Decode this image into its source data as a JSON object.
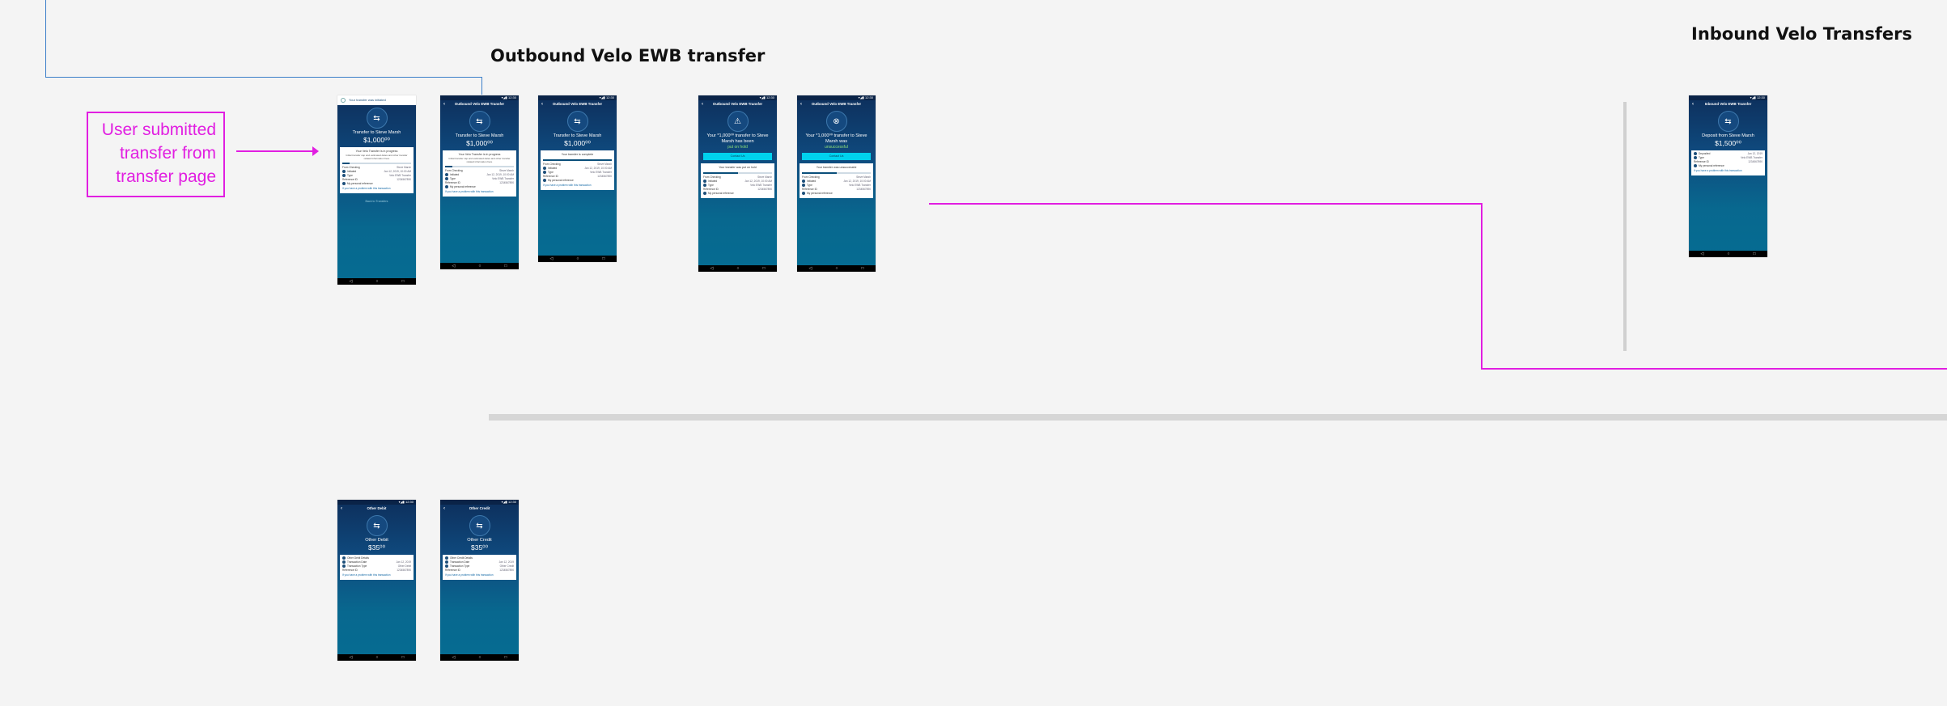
{
  "headings": {
    "outbound": "Outbound Velo EWB transfer",
    "inbound": "Inbound Velo Transfers"
  },
  "annotation": {
    "text": "User submitted transfer from transfer page"
  },
  "colors": {
    "background": "#f4f4f4",
    "annotation_magenta": "#e11ee1",
    "connector_blue": "#3b7fc9",
    "phone_top": "#0d2f5c",
    "phone_bottom": "#056c92",
    "cta_cyan": "#00d2ee"
  },
  "icons": {
    "back": "arrow-left-icon",
    "transfer": "transfer-arrows-icon",
    "nav_back": "triangle-back-icon",
    "nav_home": "circle-home-icon",
    "nav_recents": "square-recents-icon"
  },
  "nav": {
    "back": "◁",
    "home": "○",
    "recents": "□"
  },
  "screens": {
    "s1": {
      "banner": "Your transfer was initiated",
      "title": "Transfer to Steve Marsh",
      "amount": "$1,000⁰⁰",
      "card_head": "Your Velo Transfer is in progress",
      "card_text": "Initial transfer cap and estimated dates and other transfer related information here",
      "from": "From Checking",
      "to": "Steve Marsh",
      "rows": [
        [
          "Initiated",
          "Jan 12, 2019, 10:00 AM"
        ],
        [
          "Type",
          "Velo EWB Transfer"
        ],
        [
          "Reference ID",
          "1234567890"
        ]
      ],
      "memo": "My personal reference",
      "link": "If you have a problem with this transaction",
      "footer": "Back to Transfers"
    },
    "s2": {
      "appbar": "Outbound Velo EWB Transfer",
      "title": "Transfer to Steve Marsh",
      "amount": "$1,000⁰⁰",
      "card_head": "Your Velo Transfer is in progress",
      "card_text": "Initial transfer cap and estimated dates and other transfer related information here",
      "from": "From Checking",
      "to": "Steve Marsh",
      "rows": [
        [
          "Initiated",
          "Jan 12, 2019, 10:00 AM"
        ],
        [
          "Type",
          "Velo EWB Transfer"
        ],
        [
          "Reference ID",
          "1234567890"
        ]
      ],
      "memo": "My personal reference",
      "link": "If you have a problem with this transaction"
    },
    "s3": {
      "appbar": "Outbound Velo EWB Transfer",
      "title": "Transfer to Steve Marsh",
      "amount": "$1,000⁰⁰",
      "card_head": "Your transfer is complete",
      "from": "From Checking",
      "to": "Steve Marsh",
      "rows": [
        [
          "Initiated",
          "Jan 12, 2019, 10:00 AM"
        ],
        [
          "Type",
          "Velo EWB Transfer"
        ],
        [
          "Reference ID",
          "1234567890"
        ]
      ],
      "memo": "My personal reference",
      "link": "If you have a problem with this transaction"
    },
    "s4": {
      "appbar": "Outbound Velo EWB Transfer",
      "message": "Your *1,000⁰⁰ transfer to Steve Marsh has been",
      "status": "put on hold",
      "cta": "Contact Us",
      "card_head": "Your transfer was put on hold",
      "from": "From Checking",
      "to": "Steve Marsh",
      "rows": [
        [
          "Initiated",
          "Jan 12, 2019, 10:00 AM"
        ],
        [
          "Type",
          "Velo EWB Transfer"
        ],
        [
          "Reference ID",
          "1234567890"
        ]
      ],
      "memo": "My personal reference"
    },
    "s5": {
      "appbar": "Outbound Velo EWB Transfer",
      "message": "Your *1,000⁰⁰ transfer to Steve Marsh was",
      "status": "unsuccessful",
      "cta": "Contact Us",
      "card_head": "Your transfer was unsuccessful",
      "from": "From Checking",
      "to": "Steve Marsh",
      "rows": [
        [
          "Initiated",
          "Jan 12, 2019, 10:00 AM"
        ],
        [
          "Type",
          "Velo EWB Transfer"
        ],
        [
          "Reference ID",
          "1234567890"
        ]
      ],
      "memo": "My personal reference"
    },
    "s6": {
      "appbar": "Inbound Velo EWB Transfer",
      "title": "Deposit from Steve Marsh",
      "amount": "$1,500⁰⁰",
      "rows": [
        [
          "Deposited",
          "Jan 12, 2019"
        ],
        [
          "Type",
          "Velo EWB Transfer"
        ],
        [
          "Reference ID",
          "1234567890"
        ]
      ],
      "memo": "My personal reference",
      "link": "If you have a problem with this transaction"
    },
    "s7": {
      "appbar": "Other Debit",
      "title": "Other Debit",
      "amount": "$35⁰⁰",
      "rows": [
        [
          "Other Debit Details",
          ""
        ],
        [
          "Transaction Date",
          "Jan 12, 2019"
        ],
        [
          "Transaction Type",
          "Other Debit"
        ],
        [
          "Reference ID",
          "1234567890"
        ]
      ],
      "link": "If you have a problem with this transaction"
    },
    "s8": {
      "appbar": "Other Credit",
      "title": "Other Credit",
      "amount": "$35⁰⁰",
      "rows": [
        [
          "Other Credit Details",
          ""
        ],
        [
          "Transaction Date",
          "Jan 12, 2019"
        ],
        [
          "Transaction Type",
          "Other Credit"
        ],
        [
          "Reference ID",
          "1234567890"
        ]
      ],
      "link": "If you have a problem with this transaction"
    }
  }
}
